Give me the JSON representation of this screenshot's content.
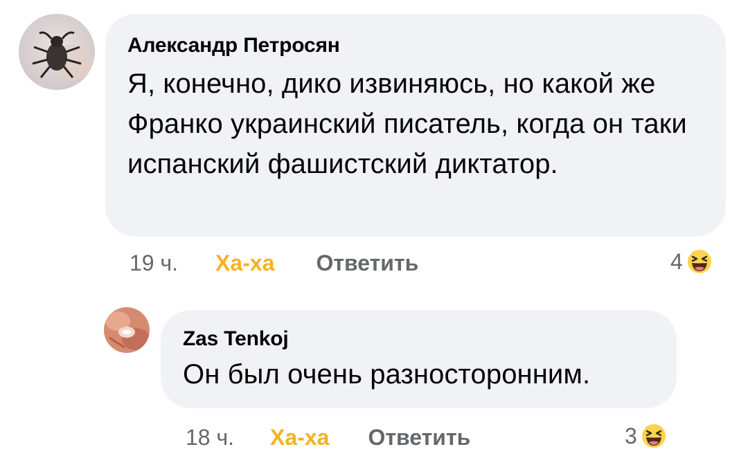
{
  "comments": [
    {
      "author": "Александр Петросян",
      "text": "Я, конечно, дико извиняюсь, но какой же Франко украинский писатель, когда он таки испанский фашистский диктатор.",
      "time": "19 ч.",
      "reaction_label": "Ха-ха",
      "reply_label": "Ответить",
      "reaction_count": "4",
      "reaction_icon": "haha-emoji-icon"
    },
    {
      "author": "Zas Tenkoj",
      "text": "Он был очень разносторонним.",
      "time": "18 ч.",
      "reaction_label": "Ха-ха",
      "reply_label": "Ответить",
      "reaction_count": "3",
      "reaction_icon": "haha-emoji-icon"
    }
  ],
  "colors": {
    "bubble": "#f0f2f5",
    "text": "#050505",
    "meta": "#65676b",
    "haha": "#f7b125"
  }
}
